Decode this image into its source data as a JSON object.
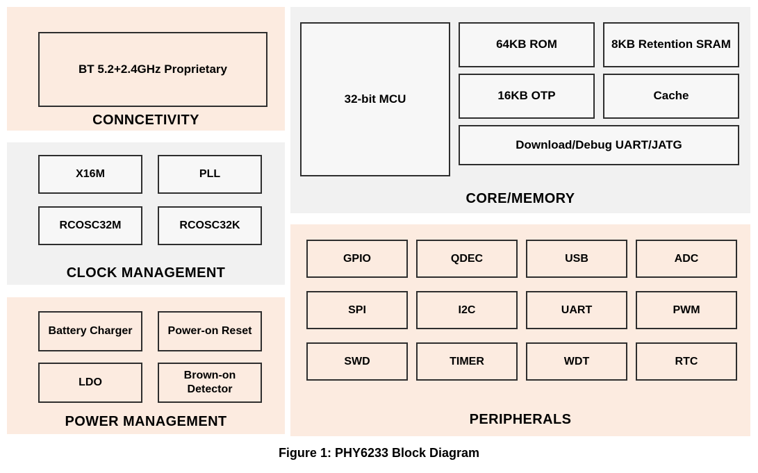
{
  "figure": {
    "caption": "Figure 1: PHY6233 Block Diagram"
  },
  "colors": {
    "peach_panel": "#fcebe0",
    "gray_panel": "#f1f1f1",
    "gray_block": "#f7f7f7",
    "block_border": "#2e2e2e",
    "text": "#000000",
    "page_background": "#ffffff"
  },
  "panels": {
    "connectivity": {
      "title": "CONNCETIVITY",
      "style": "peach",
      "blocks": [
        {
          "label": "BT 5.2+2.4GHz Proprietary"
        }
      ]
    },
    "clock": {
      "title": "CLOCK MANAGEMENT",
      "style": "gray",
      "blocks": [
        {
          "label": "X16M"
        },
        {
          "label": "PLL"
        },
        {
          "label": "RCOSC32M"
        },
        {
          "label": "RCOSC32K"
        }
      ]
    },
    "power": {
      "title": "POWER MANAGEMENT",
      "style": "peach",
      "blocks": [
        {
          "label": "Battery Charger"
        },
        {
          "label": "Power-on Reset"
        },
        {
          "label": "LDO"
        },
        {
          "label": "Brown-on Detector"
        }
      ]
    },
    "core": {
      "title": "CORE/MEMORY",
      "style": "gray",
      "blocks": [
        {
          "label": "32-bit MCU"
        },
        {
          "label": "64KB ROM"
        },
        {
          "label": "8KB Retention SRAM"
        },
        {
          "label": "16KB OTP"
        },
        {
          "label": "Cache"
        },
        {
          "label": "Download/Debug UART/JATG"
        }
      ]
    },
    "peripherals": {
      "title": "PERIPHERALS",
      "style": "peach",
      "blocks": [
        {
          "label": "GPIO"
        },
        {
          "label": "QDEC"
        },
        {
          "label": "USB"
        },
        {
          "label": "ADC"
        },
        {
          "label": "SPI"
        },
        {
          "label": "I2C"
        },
        {
          "label": "UART"
        },
        {
          "label": "PWM"
        },
        {
          "label": "SWD"
        },
        {
          "label": "TIMER"
        },
        {
          "label": "WDT"
        },
        {
          "label": "RTC"
        }
      ]
    }
  }
}
